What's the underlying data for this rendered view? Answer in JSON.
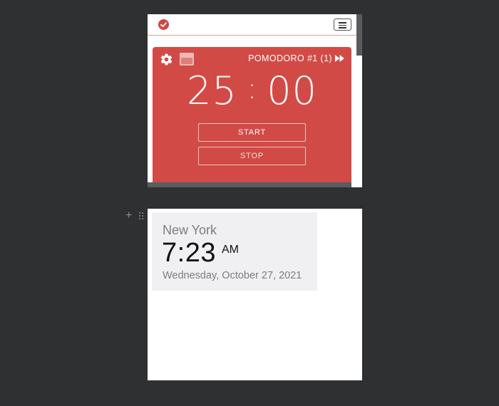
{
  "pomodoro": {
    "session_label": "POMODORO #1 (1)",
    "timer": {
      "minutes": "25",
      "separator": ":",
      "seconds": "00"
    },
    "start_label": "START",
    "stop_label": "STOP",
    "icons": {
      "logo": "check-circle-icon",
      "menu": "hamburger-menu-icon",
      "settings": "gear-icon",
      "window": "window-icon",
      "skip": "fast-forward-icon"
    },
    "colors": {
      "card": "#d24a46",
      "logo": "#d2463f"
    }
  },
  "clock": {
    "city": "New York",
    "time": "7:23",
    "ampm": "AM",
    "date": "Wednesday, October 27, 2021",
    "icons": {
      "add": "plus-icon",
      "drag": "drag-handle-icon"
    }
  },
  "colors": {
    "background": "#2f3032",
    "clock_card": "#f0f0f2"
  }
}
